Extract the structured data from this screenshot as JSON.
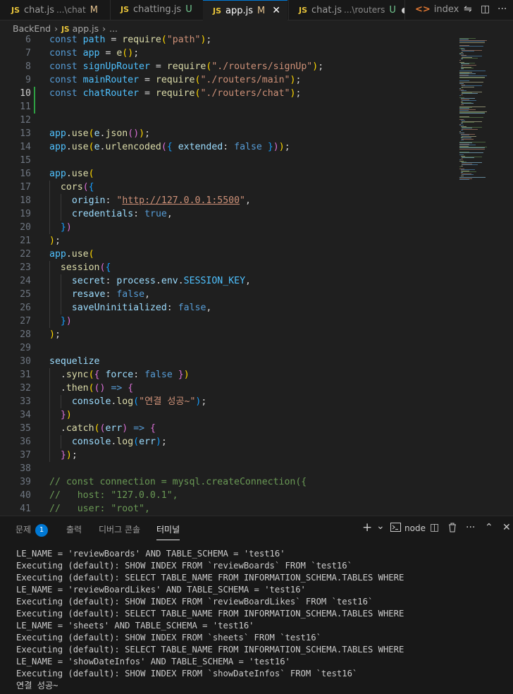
{
  "tabs": [
    {
      "icon": "JS",
      "name": "chat.js",
      "desc": "...\\chat",
      "status": "M"
    },
    {
      "icon": "JS",
      "name": "chatting.js",
      "desc": "",
      "status": "U"
    },
    {
      "icon": "JS",
      "name": "app.js",
      "desc": "",
      "status": "M"
    },
    {
      "icon": "JS",
      "name": "chat.js",
      "desc": "...\\routers",
      "status": "U"
    },
    {
      "icon": "<>",
      "name": "index.htı",
      "desc": "",
      "status": ""
    }
  ],
  "breadcrumb": {
    "folder": "BackEnd",
    "file": "app.js",
    "rest": "..."
  },
  "code_lines": [
    {
      "n": "6",
      "text": "const path = require(\"path\");"
    },
    {
      "n": "7",
      "text": "const app = e();"
    },
    {
      "n": "8",
      "text": "const signUpRouter = require(\"./routers/signUp\");"
    },
    {
      "n": "9",
      "text": "const mainRouter = require(\"./routers/main\");"
    },
    {
      "n": "10",
      "text": "const chatRouter = require(\"./routers/chat\");"
    },
    {
      "n": "11",
      "text": ""
    },
    {
      "n": "12",
      "text": ""
    },
    {
      "n": "13",
      "text": "app.use(e.json());"
    },
    {
      "n": "14",
      "text": "app.use(e.urlencoded({ extended: false }));"
    },
    {
      "n": "15",
      "text": ""
    },
    {
      "n": "16",
      "text": "app.use("
    },
    {
      "n": "17",
      "text": "  cors({"
    },
    {
      "n": "18",
      "text": "    origin: \"http://127.0.0.1:5500\","
    },
    {
      "n": "19",
      "text": "    credentials: true,"
    },
    {
      "n": "20",
      "text": "  })"
    },
    {
      "n": "21",
      "text": ");"
    },
    {
      "n": "22",
      "text": "app.use("
    },
    {
      "n": "23",
      "text": "  session({"
    },
    {
      "n": "24",
      "text": "    secret: process.env.SESSION_KEY,"
    },
    {
      "n": "25",
      "text": "    resave: false,"
    },
    {
      "n": "26",
      "text": "    saveUninitialized: false,"
    },
    {
      "n": "27",
      "text": "  })"
    },
    {
      "n": "28",
      "text": ");"
    },
    {
      "n": "29",
      "text": ""
    },
    {
      "n": "30",
      "text": "sequelize"
    },
    {
      "n": "31",
      "text": "  .sync({ force: false })"
    },
    {
      "n": "32",
      "text": "  .then(() => {"
    },
    {
      "n": "33",
      "text": "    console.log(\"연결 성공~\");"
    },
    {
      "n": "34",
      "text": "  })"
    },
    {
      "n": "35",
      "text": "  .catch((err) => {"
    },
    {
      "n": "36",
      "text": "    console.log(err);"
    },
    {
      "n": "37",
      "text": "  });"
    },
    {
      "n": "38",
      "text": ""
    },
    {
      "n": "39",
      "text": "// const connection = mysql.createConnection({"
    },
    {
      "n": "40",
      "text": "//   host: \"127.0.0.1\","
    },
    {
      "n": "41",
      "text": "//   user: \"root\","
    }
  ],
  "panel": {
    "tabs": [
      {
        "label": "문제",
        "badge": "1"
      },
      {
        "label": "출력"
      },
      {
        "label": "디버그 콘솔"
      },
      {
        "label": "터미널"
      }
    ],
    "actions": {
      "add": "+",
      "dropdown": "⌄",
      "shell_label": "node",
      "split": "◫",
      "trash": "🗑",
      "more": "···",
      "maximize": "⌃",
      "close": "✕"
    }
  },
  "terminal_lines": [
    "LE_NAME = 'reviewBoards' AND TABLE_SCHEMA = 'test16'",
    "Executing (default): SHOW INDEX FROM `reviewBoards` FROM `test16`",
    "Executing (default): SELECT TABLE_NAME FROM INFORMATION_SCHEMA.TABLES WHERE",
    "LE_NAME = 'reviewBoardLikes' AND TABLE_SCHEMA = 'test16'",
    "Executing (default): SHOW INDEX FROM `reviewBoardLikes` FROM `test16`",
    "Executing (default): SELECT TABLE_NAME FROM INFORMATION_SCHEMA.TABLES WHERE",
    "LE_NAME = 'sheets' AND TABLE_SCHEMA = 'test16'",
    "Executing (default): SHOW INDEX FROM `sheets` FROM `test16`",
    "Executing (default): SELECT TABLE_NAME FROM INFORMATION_SCHEMA.TABLES WHERE",
    "LE_NAME = 'showDateInfos' AND TABLE_SCHEMA = 'test16'",
    "Executing (default): SHOW INDEX FROM `showDateInfos` FROM `test16`",
    "연결 성공~"
  ]
}
